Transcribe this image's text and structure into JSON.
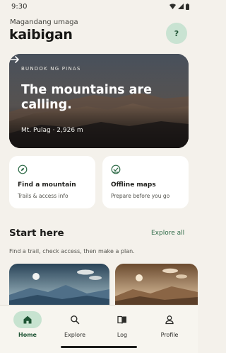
{
  "status": {
    "time": "9:30"
  },
  "header": {
    "greeting": "Magandang umaga",
    "title": "kaibigan",
    "help_label": "?"
  },
  "hero": {
    "kicker": "BUNDOK NG PINAS",
    "title": "The mountains are calling.",
    "meta": "Mt. Pulag · 2,926 m"
  },
  "cards": [
    {
      "title": "Find a mountain",
      "desc": "Trails & access info",
      "icon": "compass-icon"
    },
    {
      "title": "Offline maps",
      "desc": "Prepare before you go",
      "icon": "check-circle-icon"
    }
  ],
  "section": {
    "title": "Start here",
    "link": "Explore all",
    "subtitle": "Find a trail, check access, then make a plan."
  },
  "nav": {
    "items": [
      {
        "label": "Home",
        "icon": "home-icon",
        "active": true
      },
      {
        "label": "Explore",
        "icon": "search-icon",
        "active": false
      },
      {
        "label": "Log",
        "icon": "book-icon",
        "active": false
      },
      {
        "label": "Profile",
        "icon": "person-icon",
        "active": false
      }
    ]
  },
  "colors": {
    "accent": "#2f6b48",
    "pill": "#c7e3d0",
    "background": "#f4f1eb"
  }
}
